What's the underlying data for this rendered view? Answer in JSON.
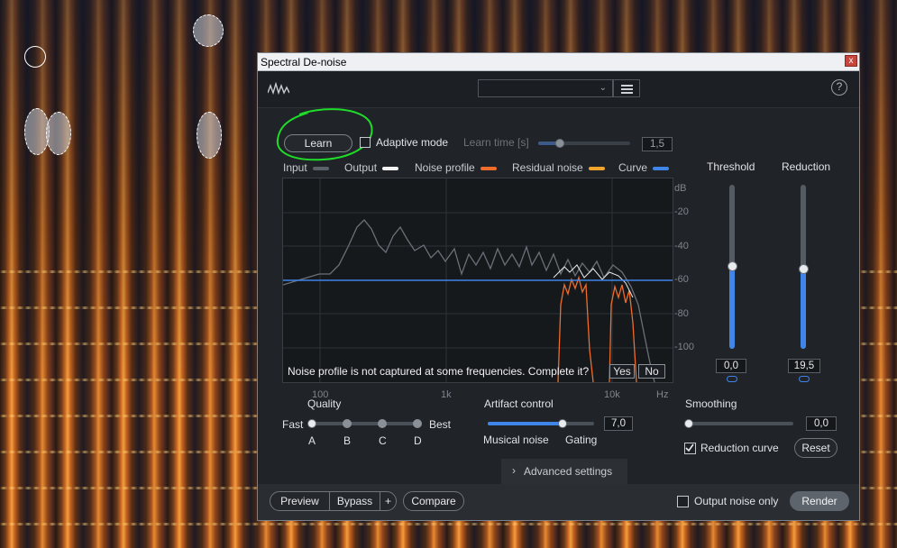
{
  "window": {
    "title": "Spectral De-noise",
    "close_glyph": "x"
  },
  "toolbar": {
    "preset_value": "",
    "logo_icon": "waveform-logo-icon",
    "menu_icon": "hamburger-icon",
    "help_label": "?"
  },
  "learn": {
    "button_label": "Learn",
    "adaptive_label": "Adaptive mode",
    "adaptive_checked": false,
    "learn_time_label": "Learn time [s]",
    "learn_time_value": "1,5",
    "learn_time_fraction": 0.25
  },
  "legend": {
    "items": [
      {
        "label": "Input",
        "color": "#5b6168"
      },
      {
        "label": "Output",
        "color": "#f2f2f2"
      },
      {
        "label": "Noise profile",
        "color": "#ef6c2a"
      },
      {
        "label": "Residual noise",
        "color": "#f2a52b"
      },
      {
        "label": "Curve",
        "color": "#3f86e8"
      }
    ]
  },
  "graph": {
    "db_unit": "dB",
    "db_ticks": [
      "-20",
      "-40",
      "-60",
      "-80",
      "-100"
    ],
    "hz_ticks": [
      "100",
      "1k",
      "10k"
    ],
    "hz_unit": "Hz",
    "prompt_text": "Noise profile is not captured at some frequencies. Complete it?",
    "yes_label": "Yes",
    "no_label": "No"
  },
  "threshold": {
    "label": "Threshold",
    "value": "0,0",
    "fraction": 0.5
  },
  "reduction": {
    "label": "Reduction",
    "value": "19,5",
    "fraction": 0.49
  },
  "quality": {
    "label": "Quality",
    "fast_label": "Fast",
    "best_label": "Best",
    "options": [
      "A",
      "B",
      "C",
      "D"
    ],
    "selected": "A"
  },
  "artifact": {
    "label": "Artifact control",
    "value": "7,0",
    "fraction": 0.7,
    "left_label": "Musical noise",
    "right_label": "Gating"
  },
  "smoothing": {
    "label": "Smoothing",
    "value": "0,0",
    "fraction": 0.0,
    "reduction_curve_label": "Reduction curve",
    "reduction_curve_checked": true,
    "reset_label": "Reset"
  },
  "advanced": {
    "label": "Advanced settings"
  },
  "bottom": {
    "preview_label": "Preview",
    "bypass_label": "Bypass",
    "plus_label": "+",
    "compare_label": "Compare",
    "output_noise_label": "Output noise only",
    "output_noise_checked": false,
    "render_label": "Render"
  },
  "colors": {
    "accent": "#3f86e8",
    "annotation": "#1fdc2a"
  }
}
